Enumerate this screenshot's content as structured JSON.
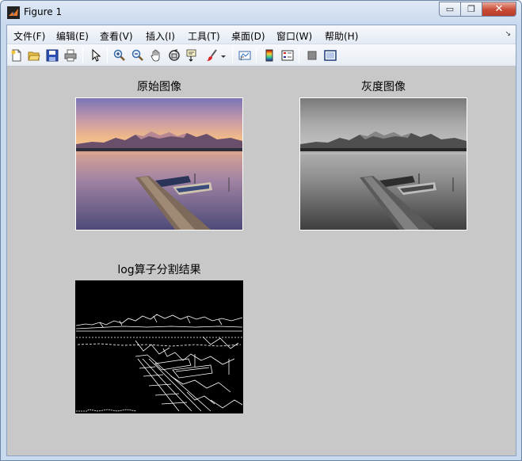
{
  "window": {
    "title": "Figure 1",
    "minimize_glyph": "▭",
    "restore_glyph": "❐",
    "close_glyph": "✕"
  },
  "menubar": {
    "items": [
      {
        "label": "文件(F)"
      },
      {
        "label": "编辑(E)"
      },
      {
        "label": "查看(V)"
      },
      {
        "label": "插入(I)"
      },
      {
        "label": "工具(T)"
      },
      {
        "label": "桌面(D)"
      },
      {
        "label": "窗口(W)"
      },
      {
        "label": "帮助(H)"
      }
    ],
    "overflow_glyph": "↘"
  },
  "toolbar": {
    "icons": [
      "new-figure-icon",
      "open-file-icon",
      "save-icon",
      "print-icon",
      "edit-plot-arrow-icon",
      "zoom-in-icon",
      "zoom-out-icon",
      "pan-hand-icon",
      "rotate-3d-icon",
      "data-cursor-icon",
      "brush-icon",
      "brush-dropdown-icon",
      "link-plot-icon",
      "insert-colorbar-icon",
      "insert-legend-icon",
      "hide-plot-tools-icon",
      "show-plot-tools-icon"
    ]
  },
  "figure": {
    "axes": [
      {
        "title": "原始图像",
        "kind": "color"
      },
      {
        "title": "灰度图像",
        "kind": "grayscale"
      },
      {
        "title": "log算子分割结果",
        "kind": "edges"
      }
    ]
  },
  "colors": {
    "figure_background": "#c8c8c8",
    "title_bar": "#dfe9f5",
    "close_button": "#c94a34"
  }
}
